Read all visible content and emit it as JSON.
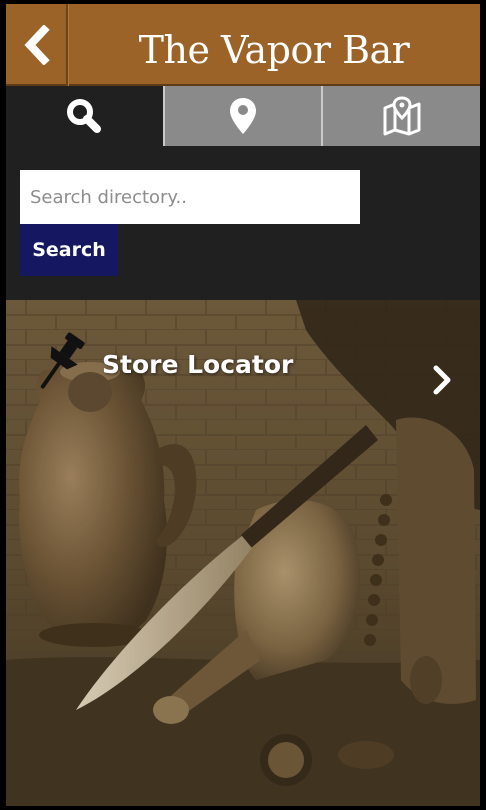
{
  "header": {
    "title": "The Vapor Bar",
    "back_icon": "chevron-left-icon"
  },
  "tabs": [
    {
      "name": "search",
      "icon": "search-icon",
      "active": true
    },
    {
      "name": "location",
      "icon": "map-pin-icon",
      "active": false
    },
    {
      "name": "map",
      "icon": "map-icon",
      "active": false
    }
  ],
  "search": {
    "placeholder": "Search directory..",
    "value": "",
    "button_label": "Search"
  },
  "locator": {
    "label": "Store Locator",
    "icon": "push-pin-icon",
    "arrow_icon": "chevron-right-icon"
  },
  "colors": {
    "header_bg": "#9c6329",
    "panel_bg": "#202020",
    "tab_inactive_bg": "#8a8a8a",
    "search_button_bg": "#161761"
  }
}
